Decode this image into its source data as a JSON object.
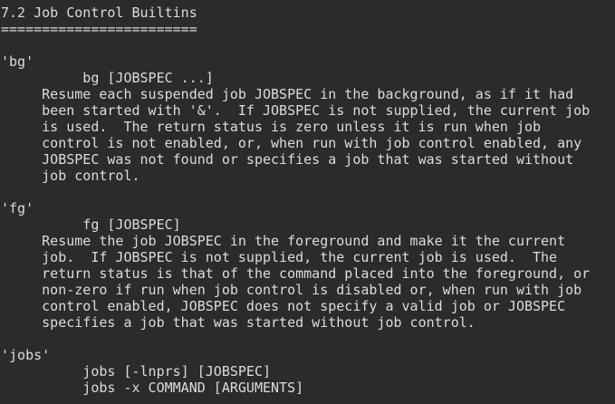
{
  "lines": [
    "7.2 Job Control Builtins",
    "========================",
    "",
    "'bg'",
    "          bg [JOBSPEC ...]",
    "     Resume each suspended job JOBSPEC in the background, as if it had",
    "     been started with '&'.  If JOBSPEC is not supplied, the current job",
    "     is used.  The return status is zero unless it is run when job",
    "     control is not enabled, or, when run with job control enabled, any",
    "     JOBSPEC was not found or specifies a job that was started without",
    "     job control.",
    "",
    "'fg'",
    "          fg [JOBSPEC]",
    "     Resume the job JOBSPEC in the foreground and make it the current",
    "     job.  If JOBSPEC is not supplied, the current job is used.  The",
    "     return status is that of the command placed into the foreground, or",
    "     non-zero if run when job control is disabled or, when run with job",
    "     control enabled, JOBSPEC does not specify a valid job or JOBSPEC",
    "     specifies a job that was started without job control.",
    "",
    "'jobs'",
    "          jobs [-lnprs] [JOBSPEC]",
    "          jobs -x COMMAND [ARGUMENTS]"
  ]
}
